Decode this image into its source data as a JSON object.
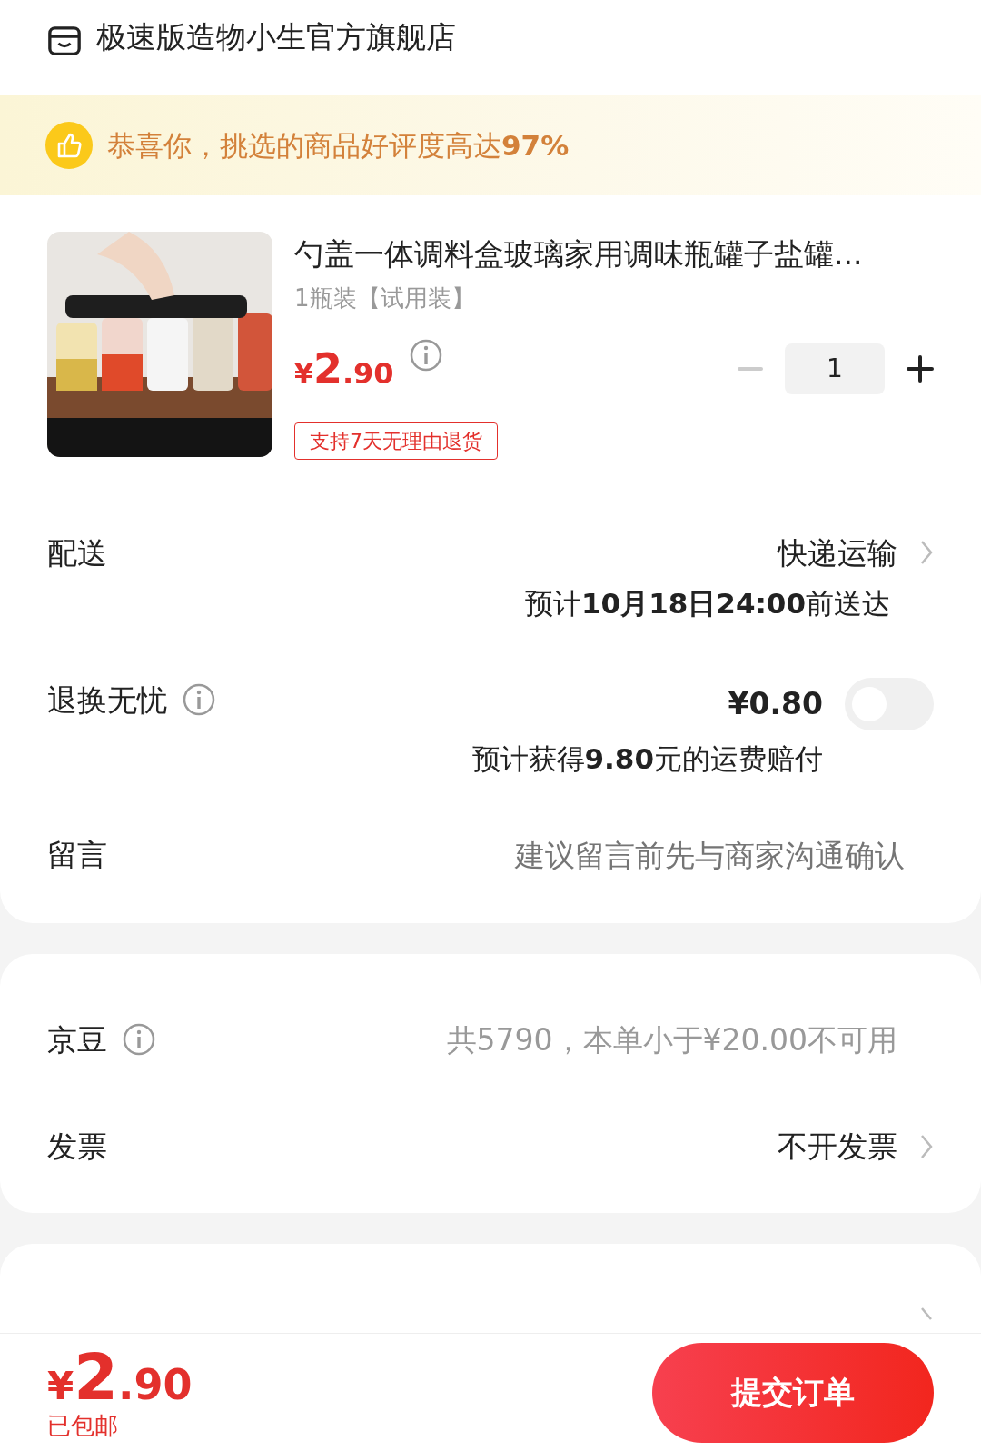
{
  "shop": {
    "name": "极速版造物小生官方旗舰店"
  },
  "banner": {
    "text": "恭喜你，挑选的商品好评度高达**97%**"
  },
  "product": {
    "title": "勺盖一体调料盒玻璃家用调味瓶罐子盐罐...",
    "spec": "1瓶装【试用装】",
    "price": {
      "symbol": "¥",
      "integer": "2",
      "decimal": ".90"
    },
    "quantity": "1",
    "tag": "支持7天无理由退货"
  },
  "rows": [
    {
      "kind": "delivery",
      "label": "配送",
      "value": "快递运输",
      "note": "预计**10月18日24:00**前送达",
      "info": false,
      "arrow": true
    },
    {
      "kind": "insurance",
      "label": "退换无忧",
      "value": "¥0.80",
      "note": "预计获得**9.80**元的运费赔付",
      "info": true,
      "on": false
    },
    {
      "kind": "message",
      "label": "留言",
      "placeholder": "建议留言前先与商家沟通确认"
    }
  ],
  "rows2": [
    {
      "label": "京豆",
      "value": "共5790，本单小于¥20.00不可用",
      "info": true,
      "arrow": false,
      "muted": true
    },
    {
      "label": "发票",
      "value": "不开发票",
      "info": false,
      "arrow": true,
      "muted": false
    }
  ],
  "footer": {
    "price": {
      "symbol": "¥",
      "integer": "2",
      "decimal": ".90"
    },
    "shipping": "已包邮",
    "submit": "提交订单"
  }
}
